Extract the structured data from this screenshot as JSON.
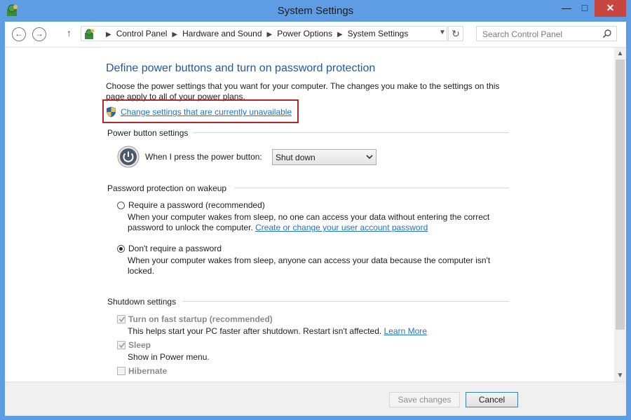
{
  "window": {
    "title": "System Settings"
  },
  "caption": {
    "minimize": "—",
    "maximize": "□",
    "close": "✕"
  },
  "nav": {
    "back": "←",
    "forward": "→",
    "up": "↑",
    "refresh": "↻"
  },
  "breadcrumbs": [
    "Control Panel",
    "Hardware and Sound",
    "Power Options",
    "System Settings"
  ],
  "search": {
    "placeholder": "Search Control Panel"
  },
  "page": {
    "heading": "Define power buttons and turn on password protection",
    "intro": "Choose the power settings that you want for your computer. The changes you make to the settings on this page apply to all of your power plans.",
    "change_link": "Change settings that are currently unavailable"
  },
  "power_button": {
    "group": "Power button settings",
    "label": "When I press the power button:",
    "value": "Shut down"
  },
  "password": {
    "group": "Password protection on wakeup",
    "require_label": "Require a password (recommended)",
    "require_desc": "When your computer wakes from sleep, no one can access your data without entering the correct password to unlock the computer.",
    "require_link": "Create or change your user account password",
    "require_selected": false,
    "dont_label": "Don't require a password",
    "dont_desc": "When your computer wakes from sleep, anyone can access your data because the computer isn't locked.",
    "dont_selected": true
  },
  "shutdown": {
    "group": "Shutdown settings",
    "fast_label": "Turn on fast startup (recommended)",
    "fast_checked": true,
    "fast_desc": "This helps start your PC faster after shutdown. Restart isn't affected.",
    "fast_link": "Learn More",
    "sleep_label": "Sleep",
    "sleep_checked": true,
    "sleep_desc": "Show in Power menu.",
    "hibernate_label": "Hibernate",
    "hibernate_checked": false
  },
  "footer": {
    "save": "Save changes",
    "cancel": "Cancel"
  },
  "icons": {
    "app": "control-panel-icon",
    "address": "control-panel-icon",
    "shield": "uac-shield-icon",
    "power": "power-icon",
    "search": "search-icon"
  },
  "colors": {
    "titlebar": "#5e9de3",
    "link": "#1f73c9",
    "heading": "#1d5aa8",
    "highlight_box": "#b3262b",
    "close": "#c7463f"
  }
}
